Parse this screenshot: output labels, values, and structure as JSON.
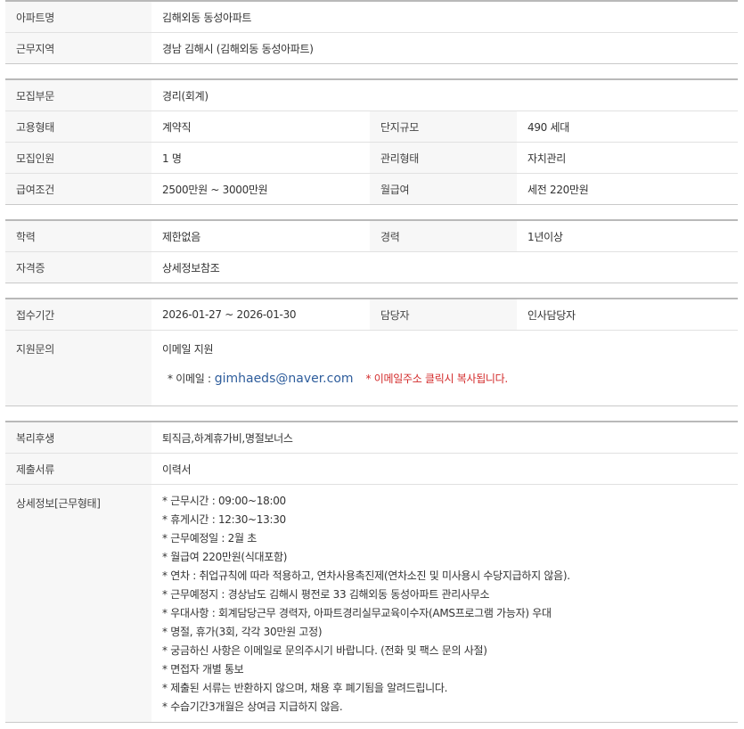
{
  "section1": {
    "apt_name_label": "아파트명",
    "apt_name_value": "김해외동 동성아파트",
    "location_label": "근무지역",
    "location_value": "경남  김해시 (김해외동 동성아파트)"
  },
  "section2": {
    "dept_label": "모집부문",
    "dept_value": "경리(회계)",
    "emp_type_label": "고용형태",
    "emp_type_value": "계약직",
    "scale_label": "단지규모",
    "scale_value": "490 세대",
    "count_label": "모집인원",
    "count_value": "1 명",
    "mgmt_label": "관리형태",
    "mgmt_value": "자치관리",
    "salary_label": "급여조건",
    "salary_value": "2500만원 ~ 3000만원",
    "monthly_label": "월급여",
    "monthly_value": "세전 220만원"
  },
  "section3": {
    "edu_label": "학력",
    "edu_value": "제한없음",
    "career_label": "경력",
    "career_value": "1년이상",
    "cert_label": "자격증",
    "cert_value": "상세정보참조"
  },
  "section4": {
    "period_label": "접수기간",
    "period_value": "2026-01-27 ~ 2026-01-30",
    "manager_label": "담당자",
    "manager_value": "인사담당자",
    "inquiry_label": "지원문의",
    "inquiry_method": "이메일 지원",
    "email_prefix": "* 이메일   :",
    "email": "gimhaeds@naver.com",
    "email_note": "* 이메일주소 클릭시 복사됩니다."
  },
  "section5": {
    "welfare_label": "복리후생",
    "welfare_value": "퇴직금,하계휴가비,명절보너스",
    "docs_label": "제출서류",
    "docs_value": "이력서",
    "detail_label": "상세정보[근무형태]",
    "detail_lines": [
      "* 근무시간 : 09:00~18:00",
      "* 휴게시간 : 12:30~13:30",
      "* 근무예정일 : 2월 초",
      "* 월급여 220만원(식대포함)",
      "* 연차 : 취업규칙에 따라 적용하고, 연차사용촉진제(연차소진 및 미사용시 수당지급하지 않음).",
      "* 근무예정지 : 경상남도 김해시 평전로 33 김해외동 동성아파트 관리사무소",
      "* 우대사항 : 회계담당근무 경력자, 아파트경리실무교육이수자(AMS프로그램 가능자) 우대",
      "* 명절, 휴가(3회, 각각 30만원 고정)",
      "* 궁금하신 사항은 이메일로 문의주시기 바랍니다. (전화 및 팩스 문의 사절)",
      "* 면접자 개별 통보",
      "* 제출된 서류는 반환하지 않으며, 채용 후 폐기됨을 알려드립니다.",
      "* 수습기간3개월은 상여금 지급하지 않음."
    ]
  }
}
